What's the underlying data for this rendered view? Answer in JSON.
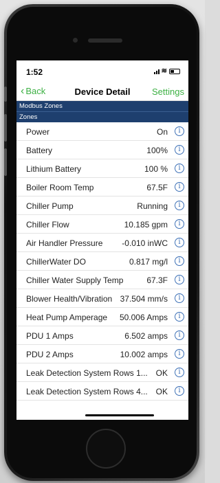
{
  "status_bar": {
    "time": "1:52"
  },
  "nav": {
    "back_label": "Back",
    "title": "Device Detail",
    "settings_label": "Settings"
  },
  "sections": {
    "modbus_zones": "Modbus Zones",
    "zones": "Zones"
  },
  "rows": [
    {
      "label": "Power",
      "value": "On"
    },
    {
      "label": "Battery",
      "value": "100%"
    },
    {
      "label": "Lithium Battery",
      "value": "100 %"
    },
    {
      "label": "Boiler Room Temp",
      "value": "67.5F"
    },
    {
      "label": "Chiller Pump",
      "value": "Running"
    },
    {
      "label": "Chiller Flow",
      "value": "10.185 gpm"
    },
    {
      "label": "Air Handler Pressure",
      "value": "-0.010 inWC"
    },
    {
      "label": "ChillerWater DO",
      "value": "0.817 mg/l"
    },
    {
      "label": "Chiller Water Supply Temp",
      "value": "67.3F"
    },
    {
      "label": "Blower Health/Vibration",
      "value": "37.504 mm/s"
    },
    {
      "label": "Heat Pump Amperage",
      "value": "50.006 Amps"
    },
    {
      "label": "PDU 1 Amps",
      "value": "6.502 amps"
    },
    {
      "label": "PDU 2 Amps",
      "value": "10.002 amps"
    },
    {
      "label": "Leak Detection System Rows 1...",
      "value": "OK"
    },
    {
      "label": "Leak Detection System Rows 4...",
      "value": "OK"
    }
  ],
  "icons": {
    "back": "chevron-left-icon",
    "info": "info-icon"
  },
  "colors": {
    "accent": "#3cb043",
    "section_header": "#1e3f6e",
    "info": "#3b6fb6"
  }
}
